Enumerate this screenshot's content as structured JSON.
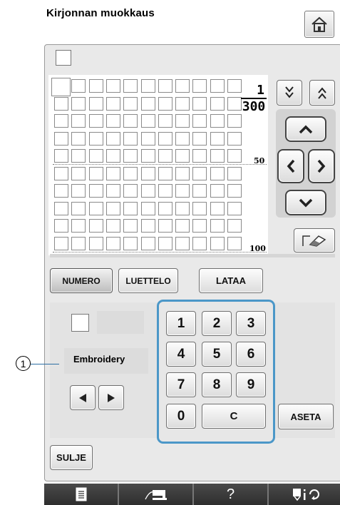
{
  "header": {
    "title": "Kirjonnan muokkaus",
    "home_icon": "home-icon"
  },
  "stitch_grid": {
    "counter_numerator": "1",
    "counter_denominator": "300",
    "mark_50": "50",
    "mark_100": "100"
  },
  "scroll_buttons": {
    "down_icon": "page-down-icon",
    "up_icon": "page-up-icon"
  },
  "arrows": {
    "up": "arrow-up-icon",
    "left": "arrow-left-icon",
    "right": "arrow-right-icon",
    "down": "arrow-down-icon"
  },
  "eraser_icon": "eraser-icon",
  "tabs": {
    "numero": "NUMERO",
    "luettelo": "LUETTELO",
    "lataa": "LATAA"
  },
  "setting": {
    "name": "Embroidery"
  },
  "keypad": {
    "keys": [
      "1",
      "2",
      "3",
      "4",
      "5",
      "6",
      "7",
      "8",
      "9",
      "0"
    ],
    "clear": "C"
  },
  "buttons": {
    "aseta": "ASETA",
    "sulje": "SULJE"
  },
  "callout": {
    "number": "1"
  },
  "bottom_bar": {
    "help": "?"
  },
  "colors": {
    "numpad_border": "#4b97c8",
    "bar": "#3b3b3b",
    "callout_line": "#2d6fa3"
  }
}
